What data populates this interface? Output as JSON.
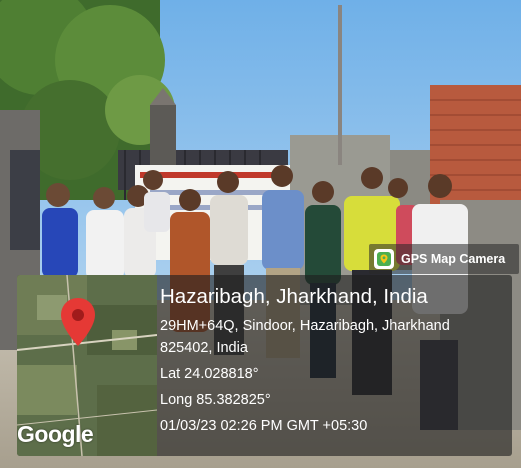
{
  "app_badge": {
    "label": "GPS Map Camera",
    "icon": "map-pin-icon"
  },
  "location": {
    "title": "Hazaribagh, Jharkhand, India",
    "address_line1": "29HM+64Q, Sindoor, Hazaribagh, Jharkhand",
    "address_line2": "825402, India",
    "latitude": "Lat 24.028818°",
    "longitude": "Long 85.382825°",
    "timestamp": "01/03/23 02:26 PM GMT +05:30"
  },
  "map": {
    "provider_logo": "Google",
    "pin_color": "#e53935"
  },
  "colors": {
    "overlay": "#1e1e1e",
    "sky": "#7fb6e6",
    "wall": "#9a9a92"
  }
}
